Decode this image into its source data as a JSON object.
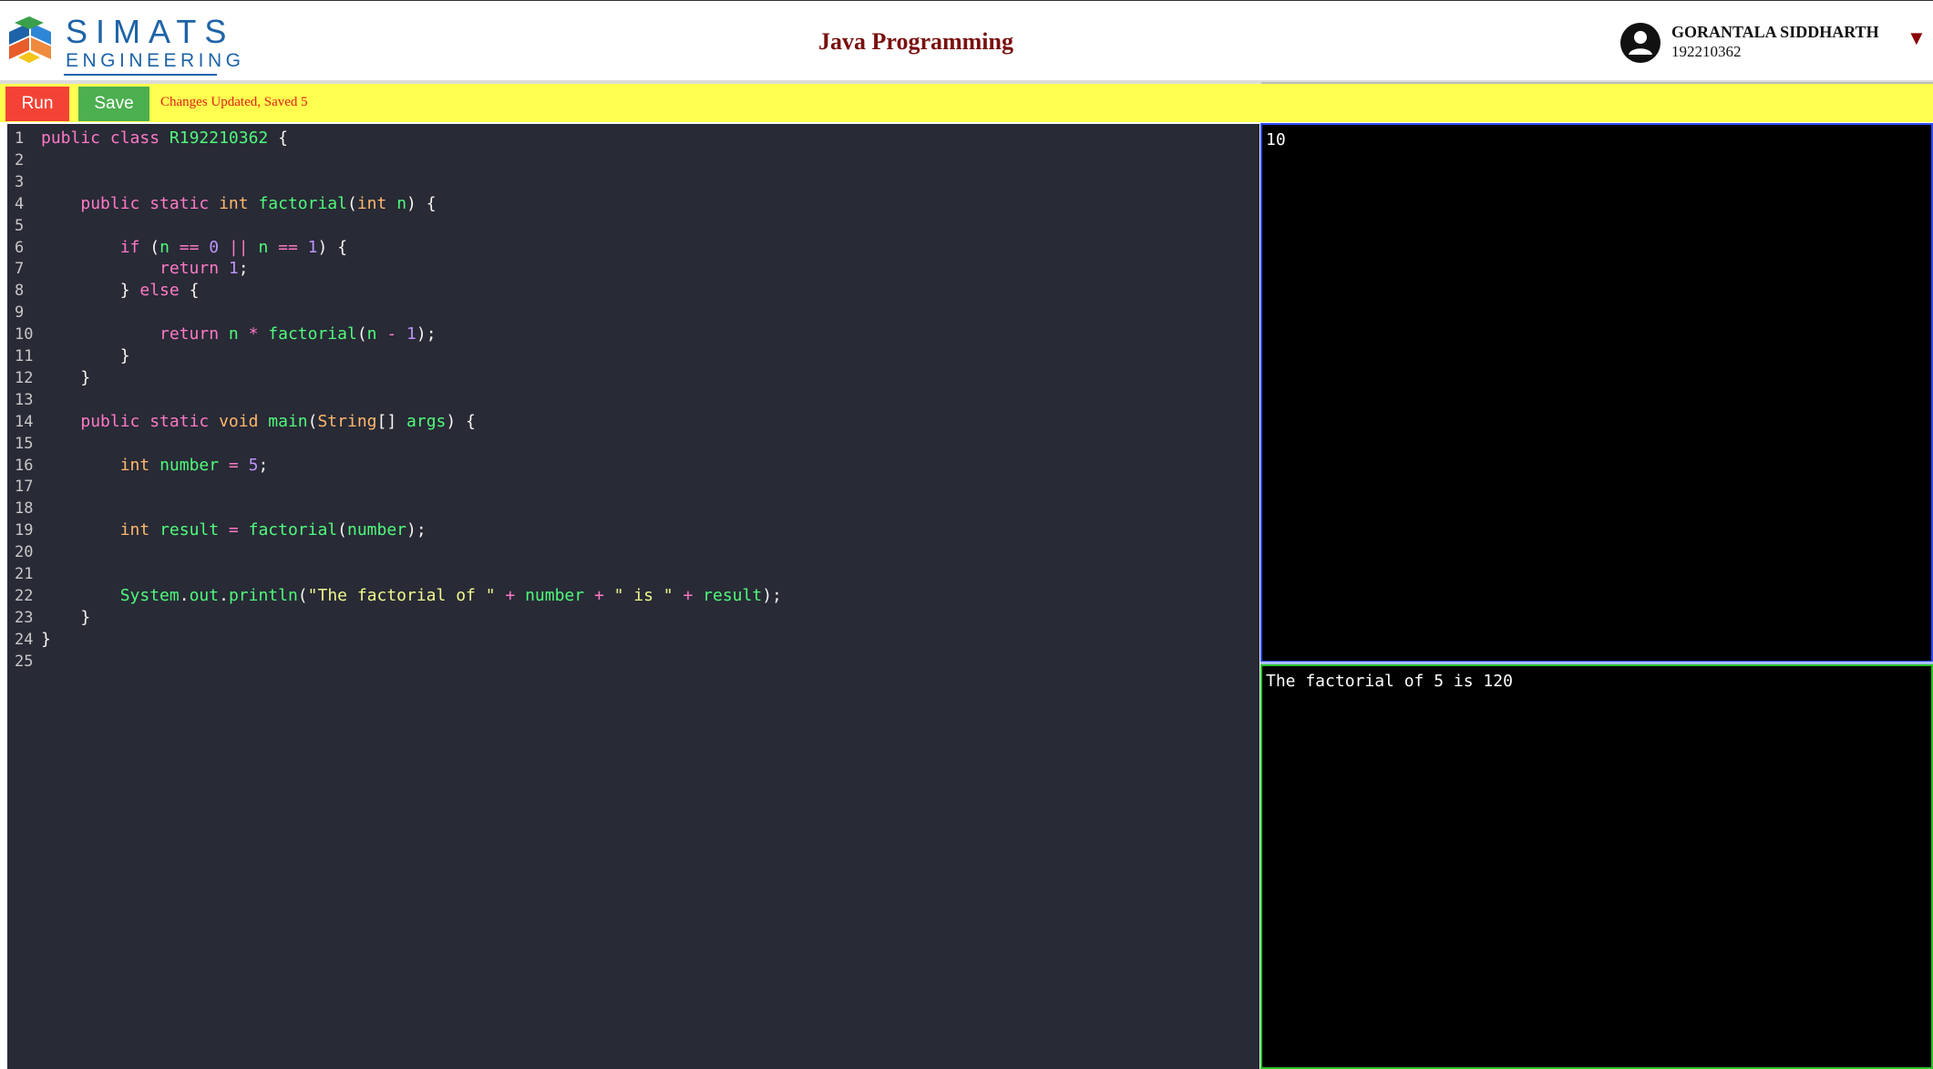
{
  "header": {
    "logo_text": "SIMATS",
    "logo_sub": "ENGINEERING",
    "title": "Java Programming",
    "user": {
      "name": "GORANTALA SIDDHARTH",
      "id": "192210362"
    },
    "dropdown_glyph": "▼"
  },
  "toolbar": {
    "run_label": "Run",
    "save_label": "Save",
    "status": "Changes Updated, Saved 5"
  },
  "editor": {
    "language": "java",
    "lines": [
      {
        "n": "1",
        "tokens": [
          [
            "kw",
            "public "
          ],
          [
            "kw",
            "class "
          ],
          [
            "fn",
            "R192210362"
          ],
          [
            "plain",
            " {"
          ]
        ]
      },
      {
        "n": "2",
        "tokens": []
      },
      {
        "n": "3",
        "tokens": []
      },
      {
        "n": "4",
        "tokens": [
          [
            "plain",
            "    "
          ],
          [
            "kw",
            "public "
          ],
          [
            "kw",
            "static "
          ],
          [
            "tp",
            "int "
          ],
          [
            "fn",
            "factorial"
          ],
          [
            "plain",
            "("
          ],
          [
            "tp",
            "int "
          ],
          [
            "var",
            "n"
          ],
          [
            "plain",
            ") {"
          ]
        ]
      },
      {
        "n": "5",
        "tokens": []
      },
      {
        "n": "6",
        "tokens": [
          [
            "plain",
            "        "
          ],
          [
            "kw",
            "if "
          ],
          [
            "plain",
            "("
          ],
          [
            "var",
            "n "
          ],
          [
            "op",
            "== "
          ],
          [
            "num",
            "0 "
          ],
          [
            "op",
            "|| "
          ],
          [
            "var",
            "n "
          ],
          [
            "op",
            "== "
          ],
          [
            "num",
            "1"
          ],
          [
            "plain",
            ") {"
          ]
        ]
      },
      {
        "n": "7",
        "tokens": [
          [
            "plain",
            "            "
          ],
          [
            "kw",
            "return "
          ],
          [
            "num",
            "1"
          ],
          [
            "plain",
            ";"
          ]
        ]
      },
      {
        "n": "8",
        "tokens": [
          [
            "plain",
            "        } "
          ],
          [
            "kw",
            "else "
          ],
          [
            "plain",
            "{"
          ]
        ]
      },
      {
        "n": "9",
        "tokens": []
      },
      {
        "n": "10",
        "tokens": [
          [
            "plain",
            "            "
          ],
          [
            "kw",
            "return "
          ],
          [
            "var",
            "n "
          ],
          [
            "op",
            "* "
          ],
          [
            "fn",
            "factorial"
          ],
          [
            "plain",
            "("
          ],
          [
            "var",
            "n "
          ],
          [
            "op",
            "- "
          ],
          [
            "num",
            "1"
          ],
          [
            "plain",
            ");"
          ]
        ]
      },
      {
        "n": "11",
        "tokens": [
          [
            "plain",
            "        }"
          ]
        ]
      },
      {
        "n": "12",
        "tokens": [
          [
            "plain",
            "    }"
          ]
        ]
      },
      {
        "n": "13",
        "tokens": []
      },
      {
        "n": "14",
        "tokens": [
          [
            "plain",
            "    "
          ],
          [
            "kw",
            "public "
          ],
          [
            "kw",
            "static "
          ],
          [
            "tp",
            "void "
          ],
          [
            "fn",
            "main"
          ],
          [
            "plain",
            "("
          ],
          [
            "tp",
            "String"
          ],
          [
            "plain",
            "[] "
          ],
          [
            "var",
            "args"
          ],
          [
            "plain",
            ") {"
          ]
        ]
      },
      {
        "n": "15",
        "tokens": []
      },
      {
        "n": "16",
        "tokens": [
          [
            "plain",
            "        "
          ],
          [
            "tp",
            "int "
          ],
          [
            "var",
            "number "
          ],
          [
            "op",
            "= "
          ],
          [
            "num",
            "5"
          ],
          [
            "plain",
            ";"
          ]
        ]
      },
      {
        "n": "17",
        "tokens": []
      },
      {
        "n": "18",
        "tokens": []
      },
      {
        "n": "19",
        "tokens": [
          [
            "plain",
            "        "
          ],
          [
            "tp",
            "int "
          ],
          [
            "var",
            "result "
          ],
          [
            "op",
            "= "
          ],
          [
            "fn",
            "factorial"
          ],
          [
            "plain",
            "("
          ],
          [
            "var",
            "number"
          ],
          [
            "plain",
            ");"
          ]
        ]
      },
      {
        "n": "20",
        "tokens": []
      },
      {
        "n": "21",
        "tokens": []
      },
      {
        "n": "22",
        "tokens": [
          [
            "plain",
            "        "
          ],
          [
            "var",
            "System"
          ],
          [
            "plain",
            "."
          ],
          [
            "var",
            "out"
          ],
          [
            "plain",
            "."
          ],
          [
            "fn",
            "println"
          ],
          [
            "plain",
            "("
          ],
          [
            "str",
            "\"The factorial of \" "
          ],
          [
            "op",
            "+ "
          ],
          [
            "var",
            "number "
          ],
          [
            "op",
            "+ "
          ],
          [
            "str",
            "\" is \" "
          ],
          [
            "op",
            "+ "
          ],
          [
            "var",
            "result"
          ],
          [
            "plain",
            ");"
          ]
        ]
      },
      {
        "n": "23",
        "tokens": [
          [
            "plain",
            "    }"
          ]
        ]
      },
      {
        "n": "24",
        "tokens": [
          [
            "plain",
            "}"
          ]
        ]
      },
      {
        "n": "25",
        "tokens": []
      }
    ]
  },
  "input_pane": {
    "text": "10"
  },
  "output_pane": {
    "text": "The factorial of 5 is 120"
  },
  "colors": {
    "toolbar_bg": "#ffff4f",
    "run": "#f44336",
    "save": "#4caf50",
    "editor_bg": "#282a36",
    "title": "#7a1010"
  }
}
